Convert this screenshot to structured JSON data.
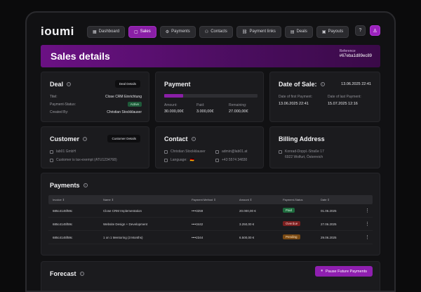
{
  "app": {
    "logo": "ioumi"
  },
  "nav": [
    {
      "icon": "▦",
      "label": "Dashboard",
      "name": "nav-dashboard",
      "active": false
    },
    {
      "icon": "▢",
      "label": "Sales",
      "name": "nav-sales",
      "active": true
    },
    {
      "icon": "⚙",
      "label": "Payments",
      "name": "nav-payments",
      "active": false
    },
    {
      "icon": "⚇",
      "label": "Contacts",
      "name": "nav-contacts",
      "active": false
    },
    {
      "icon": "⛓",
      "label": "Payment links",
      "name": "nav-payment-links",
      "active": false
    },
    {
      "icon": "▤",
      "label": "Deals",
      "name": "nav-deals",
      "active": false
    },
    {
      "icon": "▣",
      "label": "Payouts",
      "name": "nav-payouts",
      "active": false
    }
  ],
  "header_icons": {
    "help": "?",
    "user": "♙"
  },
  "banner": {
    "title": "Sales details",
    "reference_label": "Reference",
    "reference_value": "#67eba1d89ec89"
  },
  "deal": {
    "title": "Deal",
    "button": "Deal Details",
    "title_label": "Titel:",
    "title_value": "Close CRM Einrichtung",
    "status_label": "Payment-Status:",
    "status_value": "Active",
    "created_label": "Created By:",
    "created_value": "Christian Stockklauser"
  },
  "payment": {
    "title": "Payment",
    "progress": 0.2,
    "amount_label": "Amount:",
    "amount_value": "30.000,00€",
    "paid_label": "Paid:",
    "paid_value": "3.000,00€",
    "remaining_label": "Remaining:",
    "remaining_value": "27.000,00€"
  },
  "date_of_sale": {
    "title": "Date of Sale:",
    "value": "13.06.2025 22:41",
    "first_label": "Date of first Payment:",
    "first_value": "13.06.2025 22:41",
    "last_label": "Date of last Payment:",
    "last_value": "15.07.2025 12:16"
  },
  "customer": {
    "title": "Customer",
    "button": "Customer Details",
    "company": "lab01 GmbH",
    "tax": "Customer is tax-exempt (ATU1234768)"
  },
  "contact": {
    "title": "Contact",
    "name": "Christian Stockklauser",
    "email": "admin@lab01.at",
    "language_label": "Language:",
    "flag": "🇩🇪",
    "phone": "+43 5574 34830"
  },
  "billing": {
    "title": "Billing Address",
    "street": "Konrad-Doppl.-Straße 17",
    "city": "6922 Wolfurt, Österreich"
  },
  "payments": {
    "title": "Payments",
    "columns": [
      "Invoice ⇕",
      "Name ⇕",
      "Payment Method ⇕",
      "Amount ⇕",
      "Payment-Status",
      "Date ⇕"
    ],
    "rows": [
      {
        "invoice": "685c4145f59c",
        "name": "Close CRM Implementation",
        "method": "••••3259",
        "amount": "20.000,00 €",
        "status": "Paid",
        "status_class": "b-paid",
        "date": "01.06.2025"
      },
      {
        "invoice": "685c4145f59c",
        "name": "Website Design + Development",
        "method": "••••3442",
        "amount": "3.250,00 €",
        "status": "Overdue",
        "status_class": "b-overdue",
        "date": "27.06.2025"
      },
      {
        "invoice": "685c4145f59c",
        "name": "1 on 1 Mentoring (3 Months)",
        "method": "••••2344",
        "amount": "6.500,00 €",
        "status": "Pending",
        "status_class": "b-pending",
        "date": "29.06.2025"
      }
    ],
    "more": "⋮"
  },
  "forecast": {
    "title": "Forecast",
    "button": "Pause Future Payments",
    "button_icon": "⏸"
  }
}
